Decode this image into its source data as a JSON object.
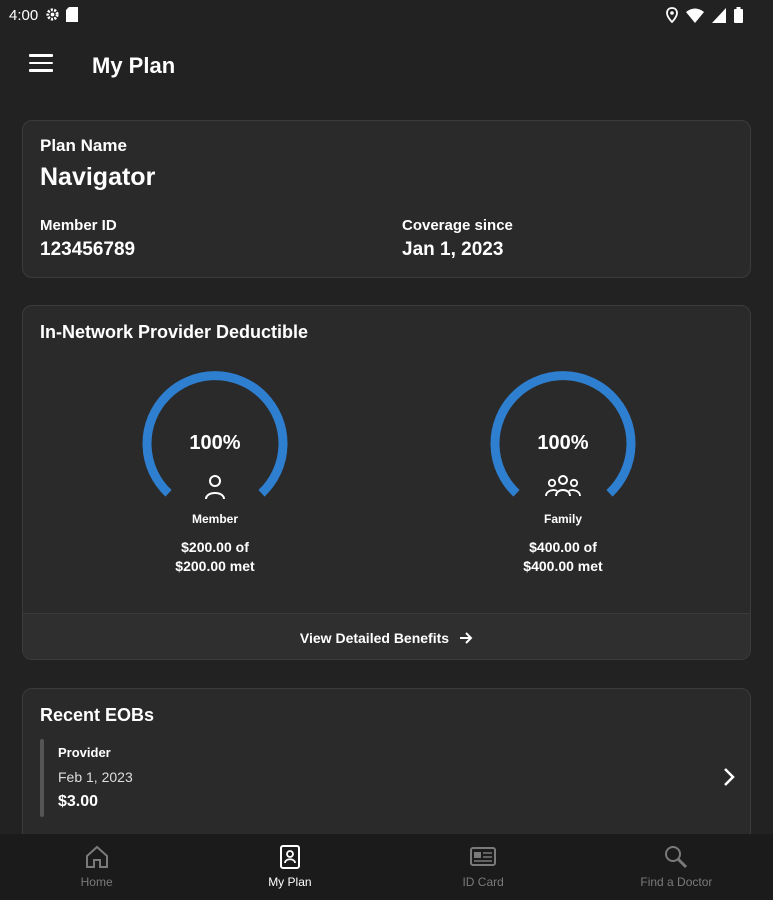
{
  "status_bar": {
    "time": "4:00"
  },
  "app_bar": {
    "title": "My Plan"
  },
  "plan": {
    "label": "Plan Name",
    "name": "Navigator",
    "member_id_label": "Member ID",
    "member_id": "123456789",
    "coverage_label": "Coverage since",
    "coverage_date": "Jan 1, 2023"
  },
  "deductible": {
    "title": "In-Network Provider Deductible",
    "member": {
      "percent": "100%",
      "progress": 1.0,
      "label": "Member",
      "amount_line1": "$200.00 of",
      "amount_line2": "$200.00 met"
    },
    "family": {
      "percent": "100%",
      "progress": 1.0,
      "label": "Family",
      "amount_line1": "$400.00 of",
      "amount_line2": "$400.00 met"
    },
    "benefits_link": "View Detailed Benefits"
  },
  "eobs": {
    "title": "Recent EOBs",
    "items": [
      {
        "provider": "Provider",
        "date": "Feb 1, 2023",
        "amount": "$3.00"
      }
    ]
  },
  "bottom_nav": {
    "items": [
      {
        "label": "Home",
        "icon": "home-icon",
        "active": false
      },
      {
        "label": "My Plan",
        "icon": "plan-document-icon",
        "active": true
      },
      {
        "label": "ID Card",
        "icon": "id-card-icon",
        "active": false
      },
      {
        "label": "Find a Doctor",
        "icon": "search-icon",
        "active": false
      }
    ]
  },
  "colors": {
    "background": "#222222",
    "card": "#2a2a2a",
    "accent": "#2f7fd0",
    "nav_inactive": "#7a7a7a"
  }
}
